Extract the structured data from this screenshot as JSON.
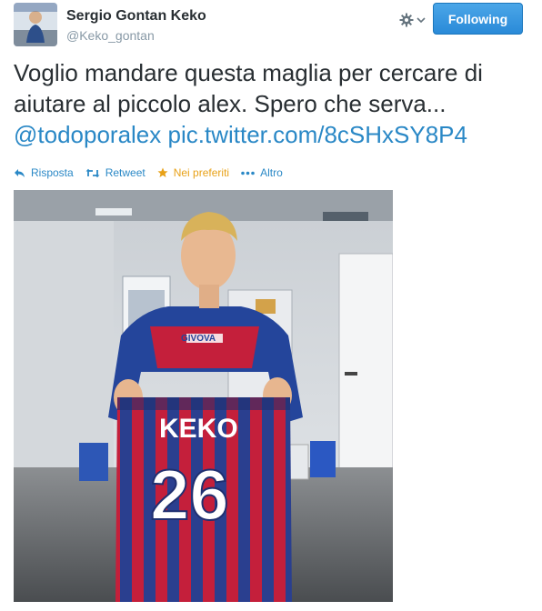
{
  "header": {
    "name": "Sergio Gontan Keko",
    "screen_name": "@Keko_gontan",
    "follow_label": "Following"
  },
  "tweet": {
    "text": "Voglio mandare questa maglia per cercare di aiutare al piccolo alex. Spero che serva...",
    "mention": "@todoporalex",
    "link": "pic.twitter.com/8cSHxSY8P4"
  },
  "actions": {
    "reply": "Risposta",
    "retweet": "Retweet",
    "favorite": "Nei preferiti",
    "more": "Altro"
  },
  "photo": {
    "jersey_name": "KEKO",
    "jersey_number": "26",
    "sponsor": "GIVOVA"
  },
  "colors": {
    "link": "#2a88c6",
    "follow_button": "#2a8ad8",
    "favorite": "#e8a117"
  }
}
